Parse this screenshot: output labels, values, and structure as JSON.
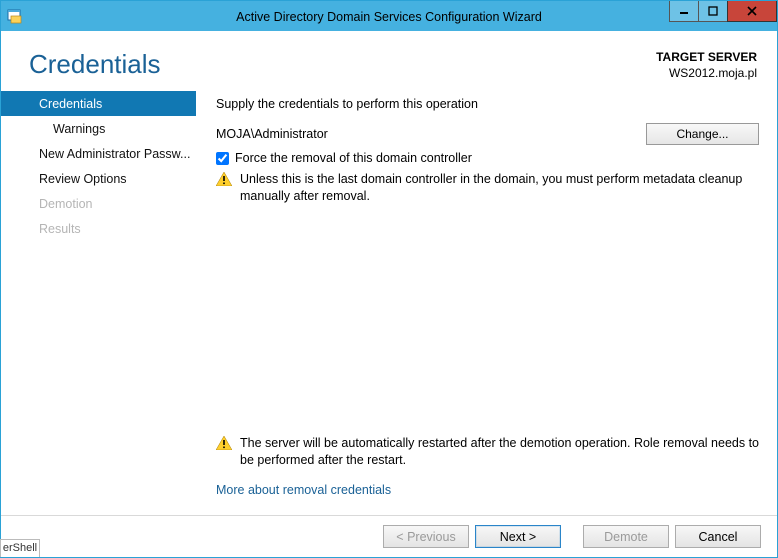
{
  "titlebar": {
    "title": "Active Directory Domain Services Configuration Wizard"
  },
  "header": {
    "page_title": "Credentials",
    "target_label": "TARGET SERVER",
    "target_server": "WS2012.moja.pl"
  },
  "sidebar": {
    "items": [
      {
        "label": "Credentials",
        "selected": true,
        "sub": false,
        "disabled": false
      },
      {
        "label": "Warnings",
        "selected": false,
        "sub": true,
        "disabled": false
      },
      {
        "label": "New Administrator Passw...",
        "selected": false,
        "sub": false,
        "disabled": false
      },
      {
        "label": "Review Options",
        "selected": false,
        "sub": false,
        "disabled": false
      },
      {
        "label": "Demotion",
        "selected": false,
        "sub": false,
        "disabled": true
      },
      {
        "label": "Results",
        "selected": false,
        "sub": false,
        "disabled": true
      }
    ]
  },
  "main": {
    "instruction": "Supply the credentials to perform this operation",
    "credential_user": "MOJA\\Administrator",
    "change_button": "Change...",
    "force_removal_label": "Force the removal of this domain controller",
    "force_removal_checked": true,
    "warning_inline": "Unless this is the last domain controller in the domain, you must perform metadata cleanup manually after removal.",
    "warning_bottom": "The server will be automatically restarted after the demotion operation. Role removal needs to be performed after the restart.",
    "more_link": "More about removal credentials"
  },
  "footer": {
    "previous": "< Previous",
    "next": "Next >",
    "demote": "Demote",
    "cancel": "Cancel"
  },
  "misc": {
    "powershell_tab": "erShell"
  }
}
